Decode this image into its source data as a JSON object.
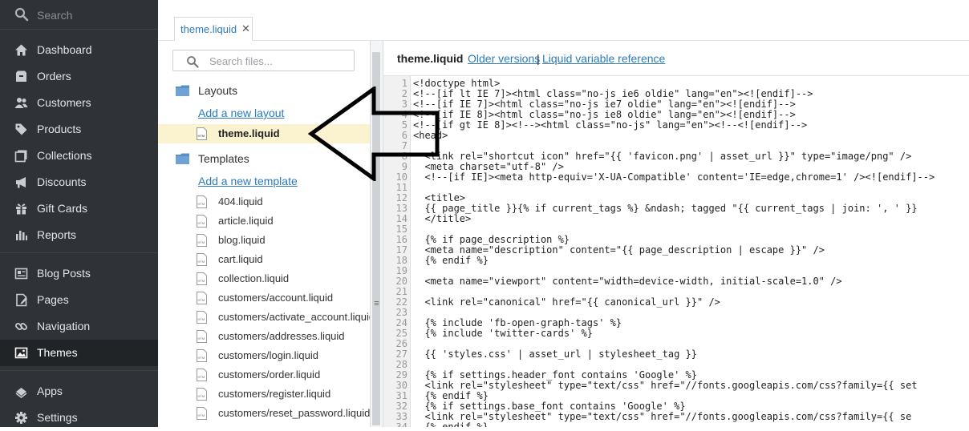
{
  "sidebar": {
    "search_placeholder": "Search",
    "items": [
      {
        "label": "Dashboard",
        "icon": "home-icon"
      },
      {
        "label": "Orders",
        "icon": "orders-icon"
      },
      {
        "label": "Customers",
        "icon": "customers-icon"
      },
      {
        "label": "Products",
        "icon": "tag-icon"
      },
      {
        "label": "Collections",
        "icon": "collections-icon"
      },
      {
        "label": "Discounts",
        "icon": "megaphone-icon"
      },
      {
        "label": "Gift Cards",
        "icon": "gift-icon"
      },
      {
        "label": "Reports",
        "icon": "bar-chart-icon"
      },
      {
        "label": "Blog Posts",
        "icon": "blog-icon"
      },
      {
        "label": "Pages",
        "icon": "pages-icon"
      },
      {
        "label": "Navigation",
        "icon": "link-icon"
      },
      {
        "label": "Themes",
        "icon": "image-icon",
        "active": true
      },
      {
        "label": "Apps",
        "icon": "apps-icon"
      },
      {
        "label": "Settings",
        "icon": "gear-icon"
      }
    ]
  },
  "tabs": [
    {
      "label": "theme.liquid",
      "close": "✕"
    }
  ],
  "files": {
    "search_placeholder": "Search files...",
    "layouts_heading": "Layouts",
    "add_layout": "Add a new layout",
    "layouts": [
      "theme.liquid"
    ],
    "templates_heading": "Templates",
    "add_template": "Add a new template",
    "templates": [
      "404.liquid",
      "article.liquid",
      "blog.liquid",
      "cart.liquid",
      "collection.liquid",
      "customers/account.liquid",
      "customers/activate_account.liquid",
      "customers/addresses.liquid",
      "customers/login.liquid",
      "customers/order.liquid",
      "customers/register.liquid",
      "customers/reset_password.liquid"
    ]
  },
  "splitter": {
    "grip": "≡"
  },
  "editor": {
    "filename": "theme.liquid",
    "older_versions": "Older versions",
    "separator": "|",
    "liquid_reference": "Liquid variable reference",
    "lines": [
      "<!doctype html>",
      "<!--[if lt IE 7]><html class=\"no-js ie6 oldie\" lang=\"en\"><![endif]-->",
      "<!--[if IE 7]><html class=\"no-js ie7 oldie\" lang=\"en\"><![endif]-->",
      "<!--[if IE 8]><html class=\"no-js ie8 oldie\" lang=\"en\"><![endif]-->",
      "<!--[if gt IE 8]><!--><html class=\"no-js\" lang=\"en\"><!--<![endif]-->",
      "<head>",
      "",
      "  <link rel=\"shortcut icon\" href=\"{{ 'favicon.png' | asset_url }}\" type=\"image/png\" />",
      "  <meta charset=\"utf-8\" />",
      "  <!--[if IE]><meta http-equiv='X-UA-Compatible' content='IE=edge,chrome=1' /><![endif]-->",
      "",
      "  <title>",
      "  {{ page_title }}{% if current_tags %} &ndash; tagged \"{{ current_tags | join: ', ' }}",
      "  </title>",
      "",
      "  {% if page_description %}",
      "  <meta name=\"description\" content=\"{{ page_description | escape }}\" />",
      "  {% endif %}",
      "",
      "  <meta name=\"viewport\" content=\"width=device-width, initial-scale=1.0\" />",
      "",
      "  <link rel=\"canonical\" href=\"{{ canonical_url }}\" />",
      "",
      "  {% include 'fb-open-graph-tags' %}",
      "  {% include 'twitter-cards' %}",
      "",
      "  {{ 'styles.css' | asset_url | stylesheet_tag }}",
      "",
      "  {% if settings.header_font contains 'Google' %}",
      "  <link rel=\"stylesheet\" type=\"text/css\" href=\"//fonts.googleapis.com/css?family={{ set",
      "  {% endif %}",
      "  {% if settings.base_font contains 'Google' %}",
      "  <link rel=\"stylesheet\" type=\"text/css\" href=\"//fonts.googleapis.com/css?family={{ se",
      "  {% endif %}"
    ]
  }
}
